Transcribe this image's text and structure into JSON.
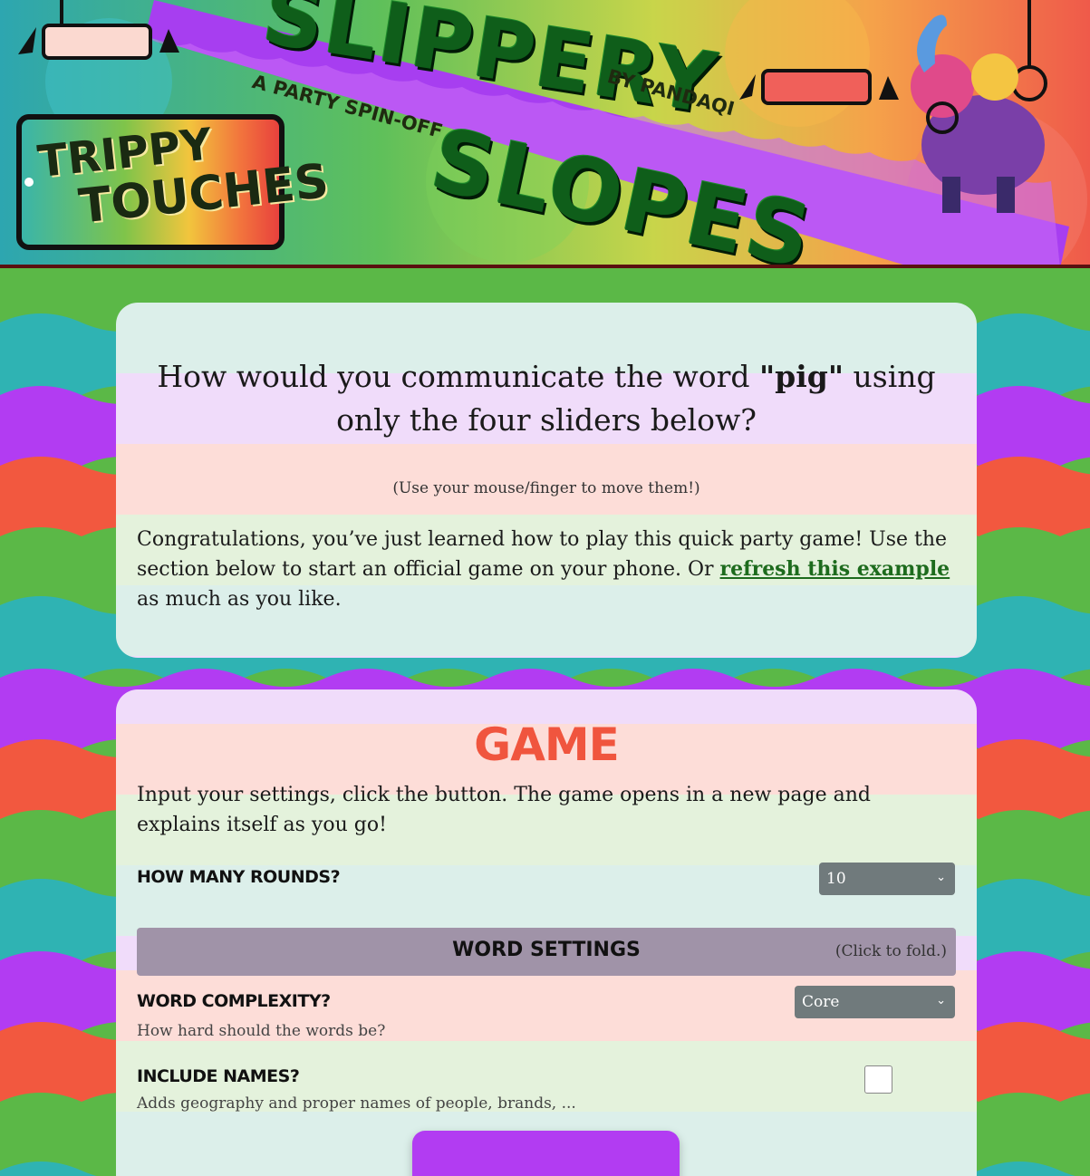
{
  "header": {
    "title_top": "SLIPPERY",
    "title_bottom": "SLOPES",
    "subtitle": "A PARTY SPIN-OFF",
    "byline": "BY PANDAQI",
    "logo_line1": "TRIPPY",
    "logo_line2": "TOUCHES"
  },
  "intro_card": {
    "question_before": "How would you communicate the word ",
    "question_word": "\"pig\"",
    "question_after": " using only the four sliders below?",
    "hint": "(Use your mouse/finger to move them!)",
    "body_before": "Congratulations, you’ve just learned how to play this quick party game! Use the section below to start an official game on your phone. Or ",
    "body_link": "refresh this example",
    "body_after": " as much as you like."
  },
  "game_card": {
    "heading": "GAME",
    "description": "Input your settings, click the button. The game opens in a new page and explains itself as you go!",
    "rounds_label": "HOW MANY ROUNDS?",
    "rounds_value": "10",
    "word_settings_title": "WORD SETTINGS",
    "word_settings_hint": "(Click to fold.)",
    "complexity_label": "WORD COMPLEXITY?",
    "complexity_desc": "How hard should the words be?",
    "complexity_value": "Core",
    "names_label": "INCLUDE NAMES?",
    "names_desc": "Adds geography and proper names of people, brands, ...",
    "names_checked": false
  },
  "colors": {
    "accent_purple": "#b23cf2",
    "heading_red": "#f0553e",
    "link_green": "#1d6b1d",
    "select_gray": "#707a7c",
    "fold_bar": "#a093a8"
  }
}
